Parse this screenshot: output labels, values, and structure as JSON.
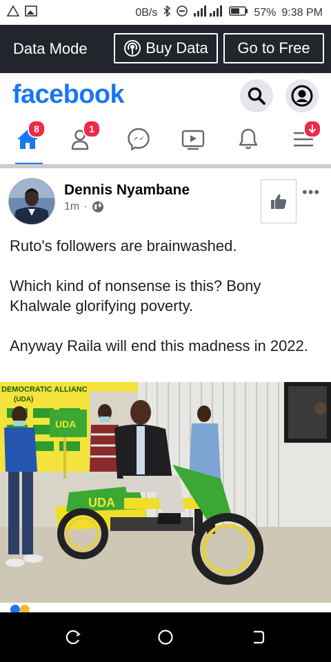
{
  "status_bar": {
    "speed": "0B/s",
    "battery": "57%",
    "time": "9:38 PM"
  },
  "data_mode": {
    "title": "Data Mode",
    "buy_label": "Buy Data",
    "free_label": "Go to Free"
  },
  "header": {
    "logo": "facebook"
  },
  "nav": {
    "home_badge": "8",
    "friends_badge": "1"
  },
  "post": {
    "author": "Dennis Nyambane",
    "time": "1m",
    "separator": "·",
    "paragraphs": [
      "Ruto's followers are brainwashed.",
      "Which kind of nonsense is this? Bony Khalwale glorifying poverty.",
      "Anyway Raila will end this madness in 2022."
    ],
    "photo_signs": {
      "banner": "DEMOCRATIC ALLIANC",
      "banner_sub": "(UDA)",
      "box_label": "UDA",
      "bike_label": "UDA"
    }
  },
  "colors": {
    "brand": "#1877f2",
    "badge": "#f02849",
    "data_bar": "#22252b"
  }
}
